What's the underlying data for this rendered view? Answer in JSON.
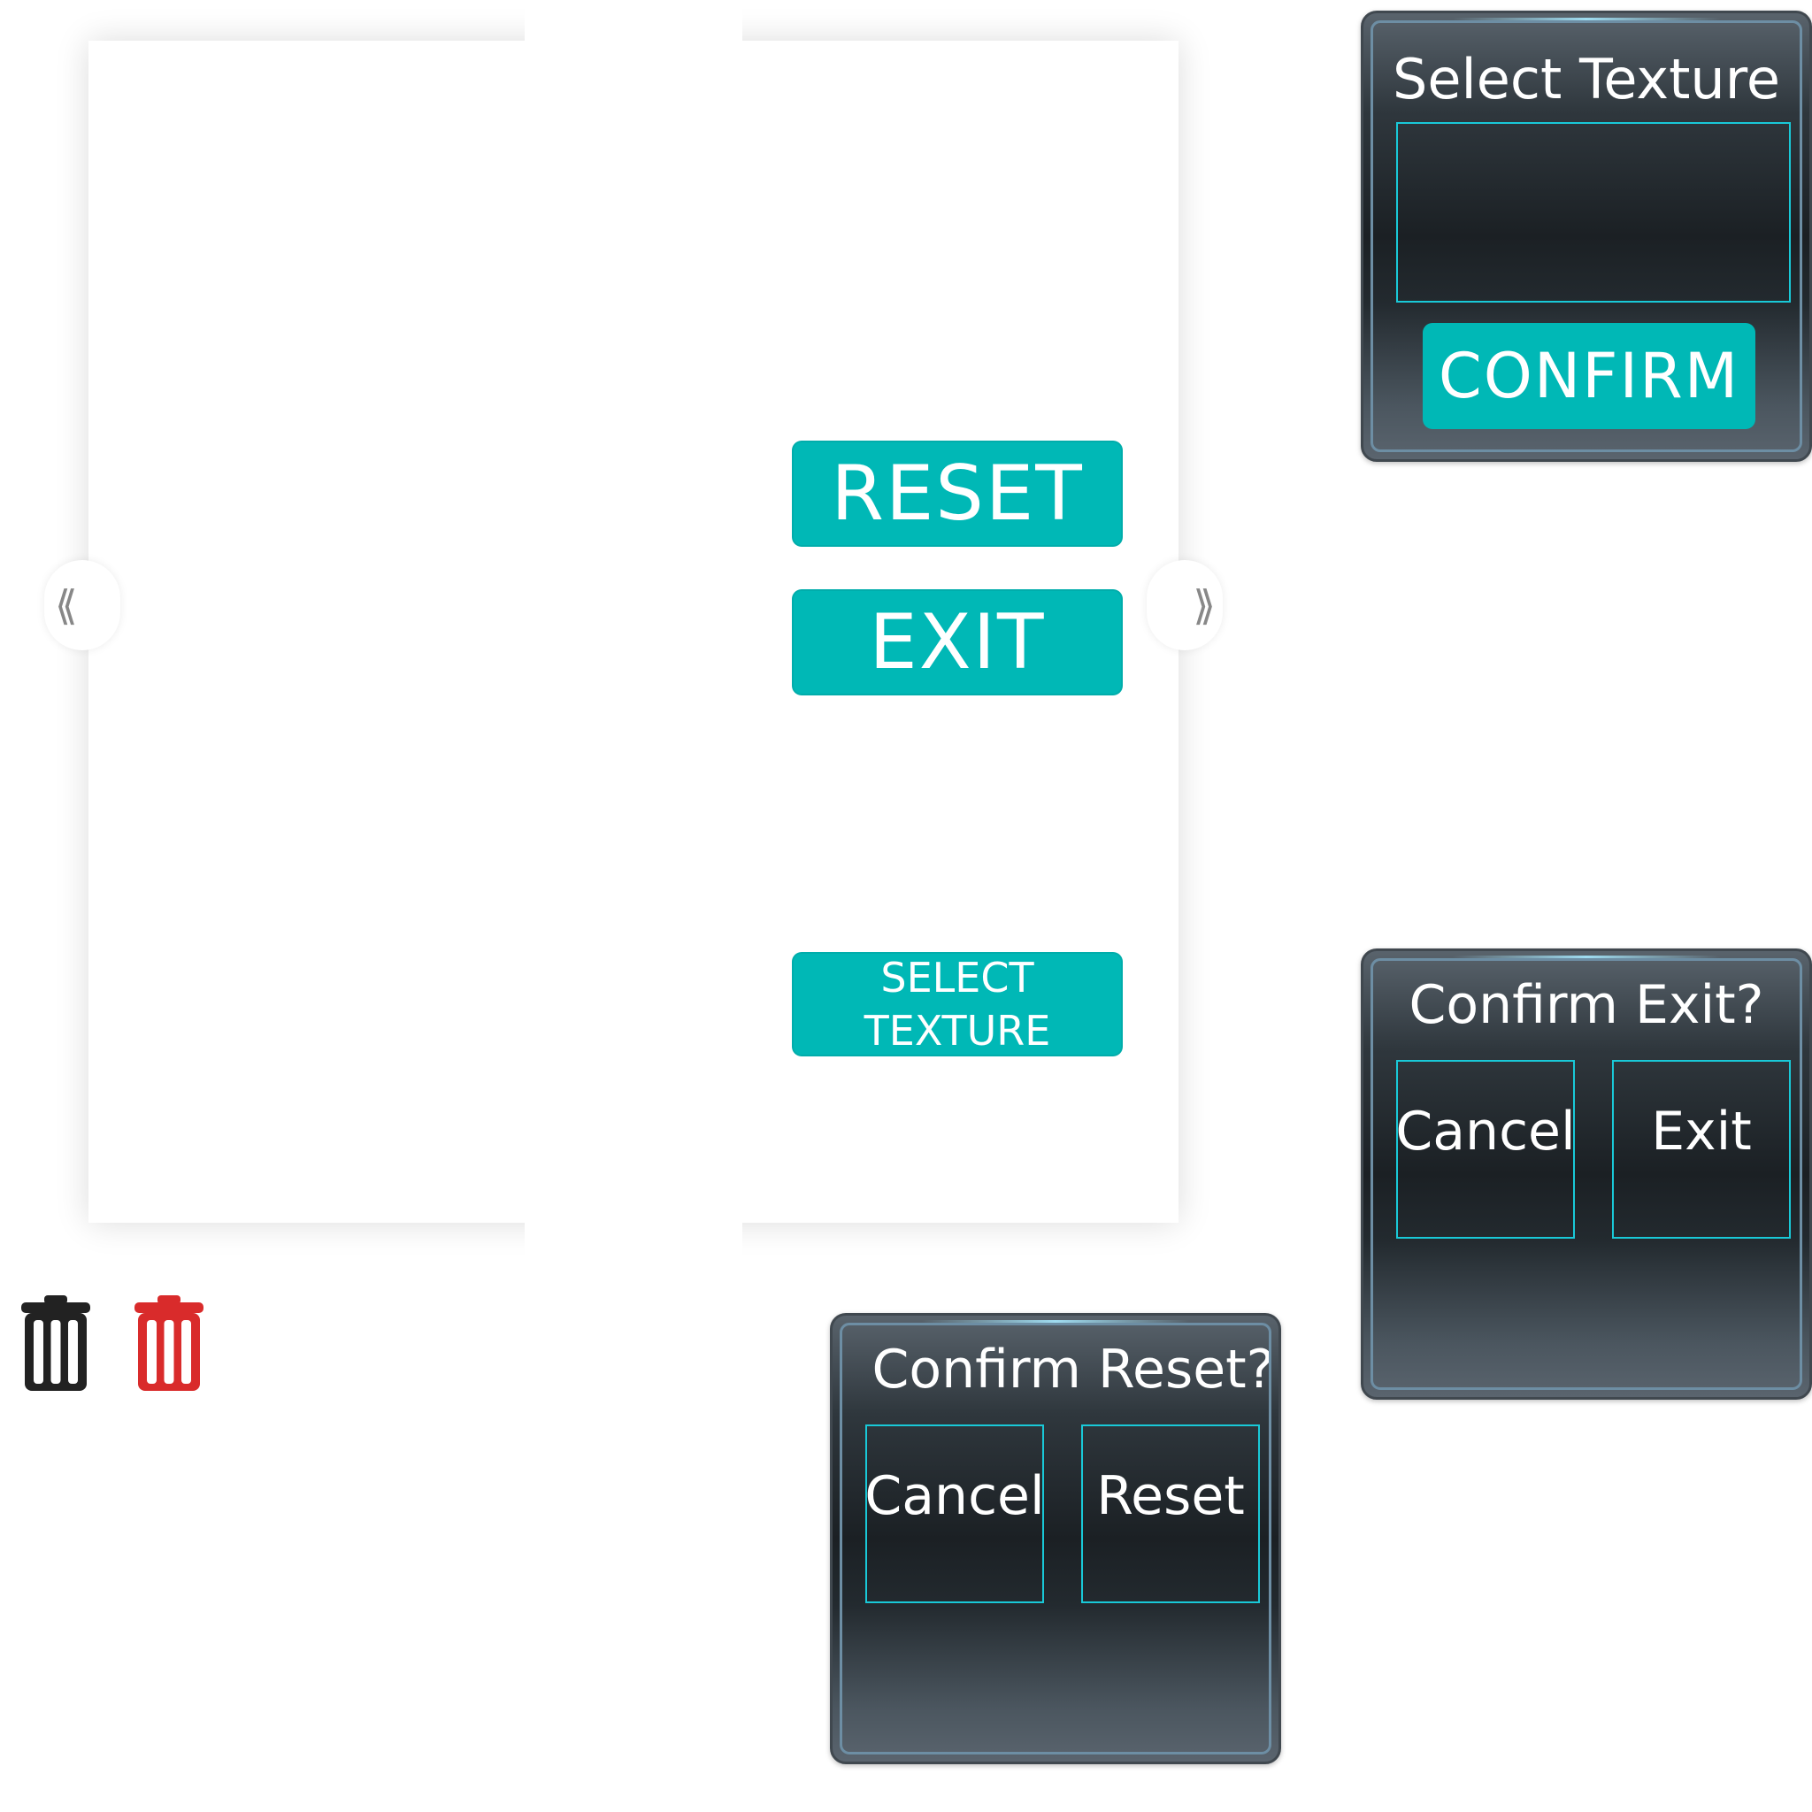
{
  "main_panel": {
    "nav_left_glyph": "⟪",
    "nav_right_glyph": "⟫"
  },
  "buttons": {
    "reset": "RESET",
    "exit": "EXIT",
    "select_texture_line1": "SELECT",
    "select_texture_line2": "TEXTURE"
  },
  "select_texture_dialog": {
    "title": "Select Texture",
    "confirm": "CONFIRM"
  },
  "confirm_exit_dialog": {
    "title": "Confirm Exit?",
    "cancel": "Cancel",
    "exit": "Exit"
  },
  "confirm_reset_dialog": {
    "title": "Confirm Reset?",
    "cancel": "Cancel",
    "reset": "Reset"
  },
  "icons": {
    "trash_black": "trash-icon",
    "trash_red": "trash-icon"
  },
  "colors": {
    "teal": "#00b8b6",
    "outline_cyan": "#19c9d8",
    "trash_red": "#d92b2b",
    "trash_black": "#222222"
  }
}
